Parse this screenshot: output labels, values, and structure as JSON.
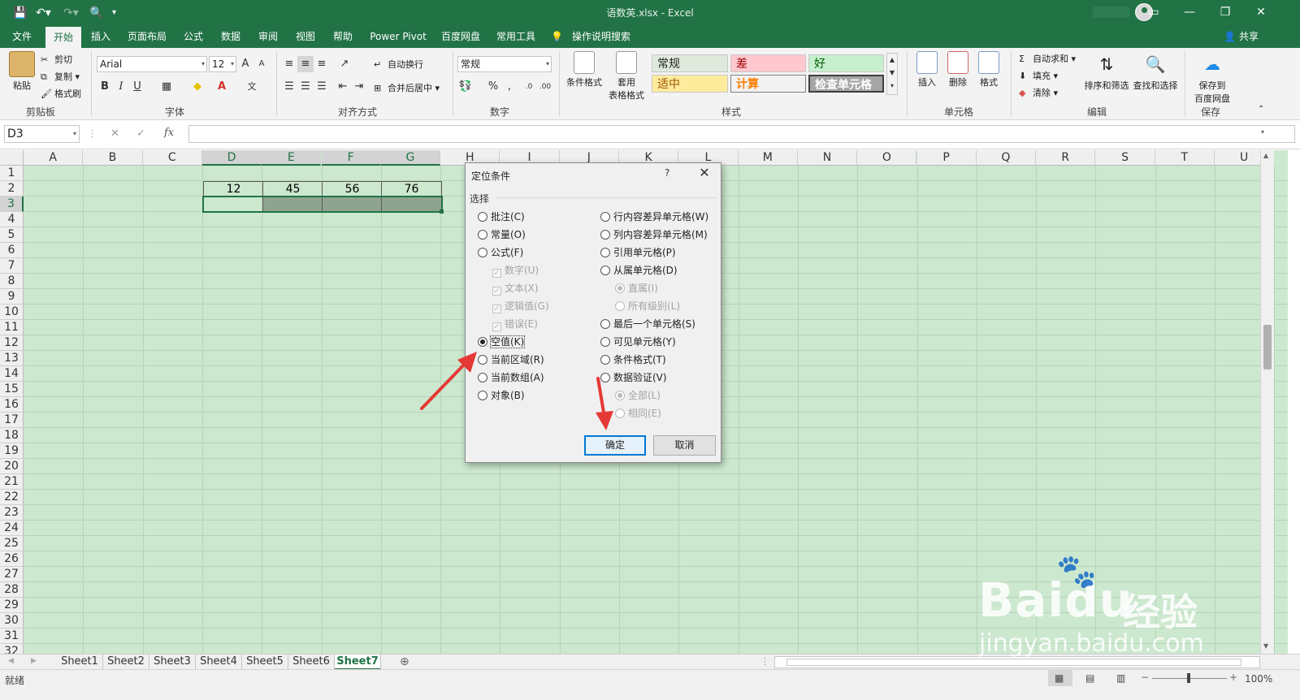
{
  "app": {
    "window_title": "语数英.xlsx - Excel",
    "share_label": "共享"
  },
  "menu_tabs": [
    "文件",
    "开始",
    "插入",
    "页面布局",
    "公式",
    "数据",
    "审阅",
    "视图",
    "帮助",
    "Power Pivot",
    "百度网盘",
    "常用工具"
  ],
  "menu_active": "开始",
  "tell_me": "操作说明搜索",
  "ribbon": {
    "clipboard": {
      "paste": "粘贴",
      "cut": "剪切",
      "copy": "复制",
      "format_painter": "格式刷",
      "label": "剪贴板"
    },
    "font": {
      "name": "Arial",
      "size": "12",
      "bold": "B",
      "italic": "I",
      "underline": "U",
      "label": "字体",
      "grow": "A",
      "shrink": "A"
    },
    "alignment": {
      "wrap": "自动换行",
      "merge": "合并后居中",
      "label": "对齐方式"
    },
    "number": {
      "format": "常规",
      "percent": "%",
      "comma": ",",
      "label": "数字"
    },
    "styles": {
      "conditional": "条件格式",
      "table_format_1": "套用",
      "table_format_2": "表格格式",
      "normal": "常规",
      "bad": "差",
      "good": "好",
      "neutral": "适中",
      "calc": "计算",
      "check": "检查单元格",
      "label": "样式"
    },
    "cells": {
      "insert": "插入",
      "delete": "删除",
      "format": "格式",
      "label": "单元格"
    },
    "editing": {
      "autosum": "自动求和",
      "fill": "填充",
      "clear": "清除",
      "sort": "排序和筛选",
      "find": "查找和选择",
      "label": "编辑"
    },
    "save": {
      "line1": "保存到",
      "line2": "百度网盘",
      "label": "保存"
    }
  },
  "formula_bar": {
    "name_box": "D3",
    "cancel": "✕",
    "enter": "✓",
    "fx": "fx",
    "value": ""
  },
  "columns": [
    "A",
    "B",
    "C",
    "D",
    "E",
    "F",
    "G",
    "H",
    "I",
    "J",
    "K",
    "L",
    "M",
    "N",
    "O",
    "P",
    "Q",
    "R",
    "S",
    "T",
    "U"
  ],
  "rows": [
    "1",
    "2",
    "3",
    "4",
    "5",
    "6",
    "7",
    "8",
    "9",
    "10",
    "11",
    "12",
    "13",
    "14",
    "15",
    "16",
    "17",
    "18",
    "19",
    "20",
    "21",
    "22",
    "23",
    "24",
    "25",
    "26",
    "27",
    "28",
    "29",
    "30",
    "31",
    "32"
  ],
  "cells": {
    "D2": "12",
    "E2": "45",
    "F2": "56",
    "G2": "76"
  },
  "sheets": [
    "Sheet1",
    "Sheet2",
    "Sheet3",
    "Sheet4",
    "Sheet5",
    "Sheet6",
    "Sheet7"
  ],
  "active_sheet": "Sheet7",
  "status": {
    "ready": "就绪",
    "zoom": "100%"
  },
  "dialog": {
    "title": "定位条件",
    "help": "?",
    "section": "选择",
    "left_options": [
      {
        "label": "批注(C)",
        "type": "radio",
        "checked": false,
        "disabled": false
      },
      {
        "label": "常量(O)",
        "type": "radio",
        "checked": false,
        "disabled": false
      },
      {
        "label": "公式(F)",
        "type": "radio",
        "checked": false,
        "disabled": false
      },
      {
        "label": "数字(U)",
        "type": "checkbox",
        "checked": true,
        "disabled": true
      },
      {
        "label": "文本(X)",
        "type": "checkbox",
        "checked": true,
        "disabled": true
      },
      {
        "label": "逻辑值(G)",
        "type": "checkbox",
        "checked": true,
        "disabled": true
      },
      {
        "label": "错误(E)",
        "type": "checkbox",
        "checked": true,
        "disabled": true
      },
      {
        "label": "空值(K)",
        "type": "radio",
        "checked": true,
        "disabled": false
      },
      {
        "label": "当前区域(R)",
        "type": "radio",
        "checked": false,
        "disabled": false
      },
      {
        "label": "当前数组(A)",
        "type": "radio",
        "checked": false,
        "disabled": false
      },
      {
        "label": "对象(B)",
        "type": "radio",
        "checked": false,
        "disabled": false
      }
    ],
    "right_options": [
      {
        "label": "行内容差异单元格(W)",
        "type": "radio",
        "checked": false,
        "disabled": false
      },
      {
        "label": "列内容差异单元格(M)",
        "type": "radio",
        "checked": false,
        "disabled": false
      },
      {
        "label": "引用单元格(P)",
        "type": "radio",
        "checked": false,
        "disabled": false
      },
      {
        "label": "从属单元格(D)",
        "type": "radio",
        "checked": false,
        "disabled": false
      },
      {
        "label": "直属(I)",
        "type": "radio",
        "checked": true,
        "disabled": true
      },
      {
        "label": "所有级别(L)",
        "type": "radio",
        "checked": false,
        "disabled": true
      },
      {
        "label": "最后一个单元格(S)",
        "type": "radio",
        "checked": false,
        "disabled": false
      },
      {
        "label": "可见单元格(Y)",
        "type": "radio",
        "checked": false,
        "disabled": false
      },
      {
        "label": "条件格式(T)",
        "type": "radio",
        "checked": false,
        "disabled": false
      },
      {
        "label": "数据验证(V)",
        "type": "radio",
        "checked": false,
        "disabled": false
      },
      {
        "label": "全部(L)",
        "type": "radio",
        "checked": true,
        "disabled": true
      },
      {
        "label": "相同(E)",
        "type": "radio",
        "checked": false,
        "disabled": true
      }
    ],
    "ok": "确定",
    "cancel": "取消"
  },
  "watermark": {
    "brand": "Baidu",
    "cn": "经验",
    "url": "jingyan.baidu.com"
  },
  "colors": {
    "excel_green": "#217346",
    "grid_bg": "#cce8cf",
    "arrow_red": "#e53935"
  }
}
